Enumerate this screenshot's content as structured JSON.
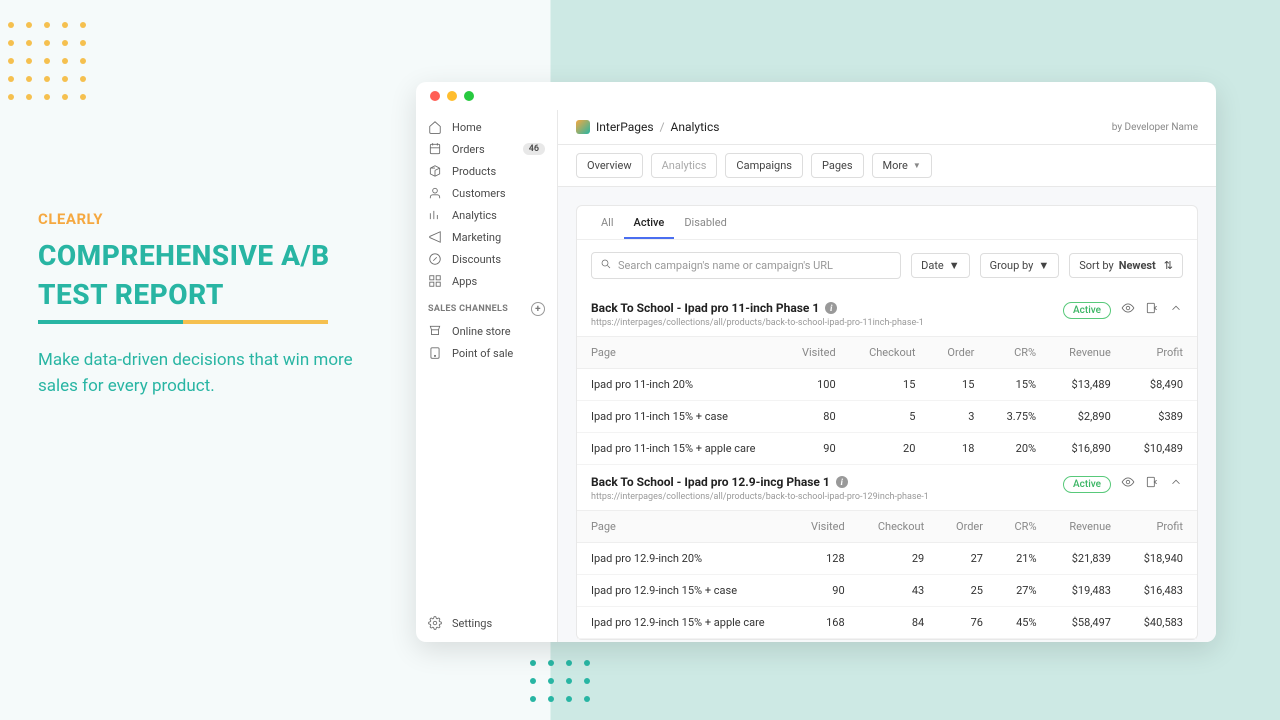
{
  "promo": {
    "kicker": "CLEARLY",
    "heading": "COMPREHENSIVE A/B TEST REPORT",
    "body": "Make data-driven decisions that win more sales for every product."
  },
  "sidebar": {
    "items": [
      {
        "label": "Home"
      },
      {
        "label": "Orders",
        "badge": "46"
      },
      {
        "label": "Products"
      },
      {
        "label": "Customers"
      },
      {
        "label": "Analytics"
      },
      {
        "label": "Marketing"
      },
      {
        "label": "Discounts"
      },
      {
        "label": "Apps"
      }
    ],
    "section": "SALES CHANNELS",
    "channels": [
      {
        "label": "Online store"
      },
      {
        "label": "Point of sale"
      }
    ],
    "settings": "Settings"
  },
  "header": {
    "brand": "InterPages",
    "page": "Analytics",
    "byline": "by Developer Name"
  },
  "tabs": [
    {
      "l": "Overview"
    },
    {
      "l": "Analytics",
      "muted": true
    },
    {
      "l": "Campaigns"
    },
    {
      "l": "Pages"
    },
    {
      "l": "More",
      "caret": true
    }
  ],
  "filters": {
    "tabs": [
      "All",
      "Active",
      "Disabled"
    ],
    "active": 1,
    "search_ph": "Search campaign's name or campaign's URL",
    "date": "Date",
    "group": "Group by",
    "sort_pre": "Sort by ",
    "sort_val": "Newest"
  },
  "cols": [
    "Page",
    "Visited",
    "Checkout",
    "Order",
    "CR%",
    "Revenue",
    "Profit"
  ],
  "campaigns": [
    {
      "title": "Back To School - Ipad pro 11-inch Phase 1",
      "url": "https://interpages/collections/all/products/back-to-school-ipad-pro-11inch-phase-1",
      "status": "Active",
      "rows": [
        {
          "page": "Ipad pro 11-inch 20%",
          "visited": "100",
          "checkout": "15",
          "order": "15",
          "cr": "15%",
          "rev": "$13,489",
          "profit": "$8,490"
        },
        {
          "page": "Ipad pro 11-inch 15% + case",
          "visited": "80",
          "checkout": "5",
          "order": "3",
          "cr": "3.75%",
          "rev": "$2,890",
          "profit": "$389"
        },
        {
          "page": "Ipad pro 11-inch 15% + apple care",
          "visited": "90",
          "checkout": "20",
          "order": "18",
          "cr": "20%",
          "rev": "$16,890",
          "profit": "$10,489"
        }
      ]
    },
    {
      "title": "Back To School - Ipad pro 12.9-incg Phase 1",
      "url": "https://interpages/collections/all/products/back-to-school-ipad-pro-129inch-phase-1",
      "status": "Active",
      "rows": [
        {
          "page": "Ipad pro 12.9-inch 20%",
          "visited": "128",
          "checkout": "29",
          "order": "27",
          "cr": "21%",
          "rev": "$21,839",
          "profit": "$18,940"
        },
        {
          "page": "Ipad pro 12.9-inch 15% + case",
          "visited": "90",
          "checkout": "43",
          "order": "25",
          "cr": "27%",
          "rev": "$19,483",
          "profit": "$16,483"
        },
        {
          "page": "Ipad pro 12.9-inch 15% + apple care",
          "visited": "168",
          "checkout": "84",
          "order": "76",
          "cr": "45%",
          "rev": "$58,497",
          "profit": "$40,583"
        }
      ]
    }
  ]
}
